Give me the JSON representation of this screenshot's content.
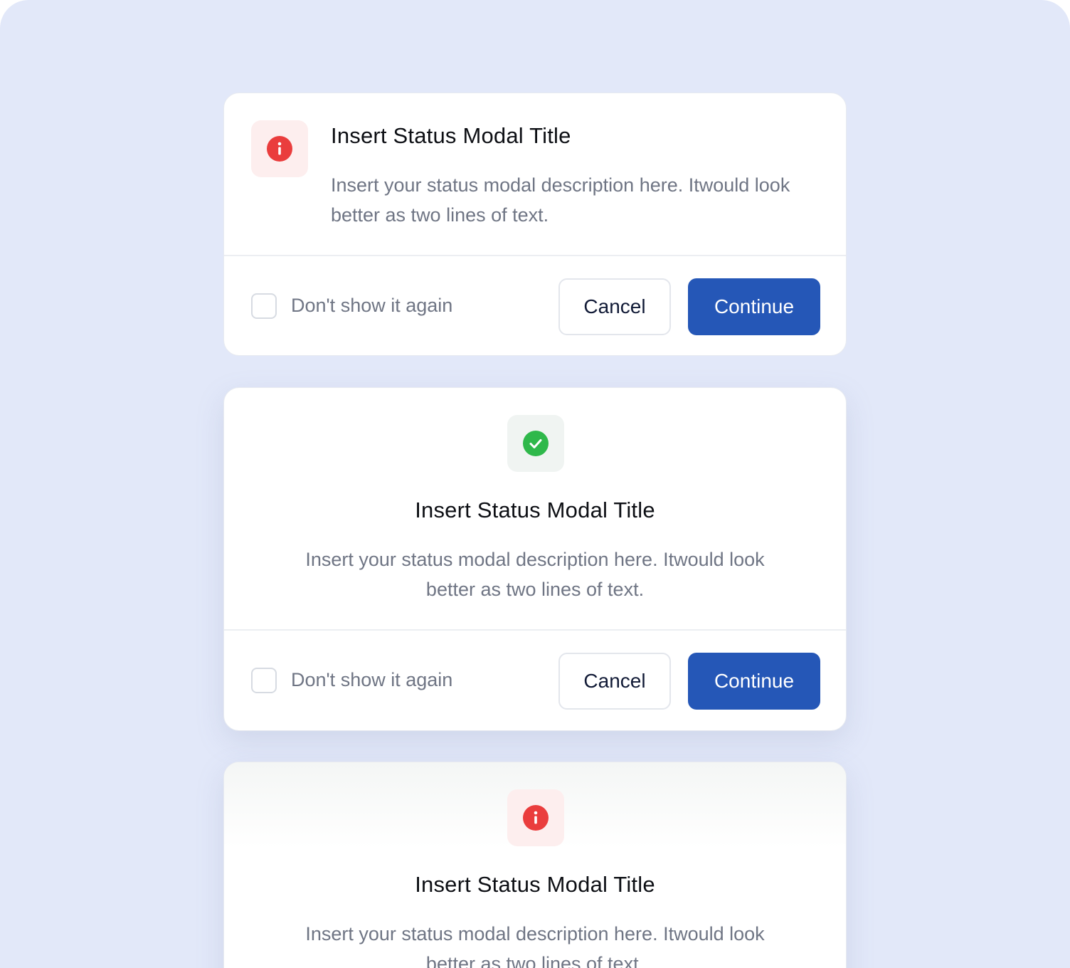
{
  "colors": {
    "background": "#e2e8f9",
    "primary": "#2557b7",
    "danger": "#ea3d3d",
    "success": "#2fb84b"
  },
  "modals": [
    {
      "icon": "info-icon",
      "title": "Insert Status Modal Title",
      "description": "Insert your status modal description here. Itwould look better as two lines of text.",
      "checkbox_label": "Don't show it again",
      "cancel_label": "Cancel",
      "continue_label": "Continue"
    },
    {
      "icon": "check-icon",
      "title": "Insert Status Modal Title",
      "description": "Insert your status modal description here. Itwould look better as two lines of text.",
      "checkbox_label": "Don't show it again",
      "cancel_label": "Cancel",
      "continue_label": "Continue"
    },
    {
      "icon": "info-icon",
      "title": "Insert Status Modal Title",
      "description": "Insert your status modal description here. Itwould look better as two lines of text."
    }
  ]
}
